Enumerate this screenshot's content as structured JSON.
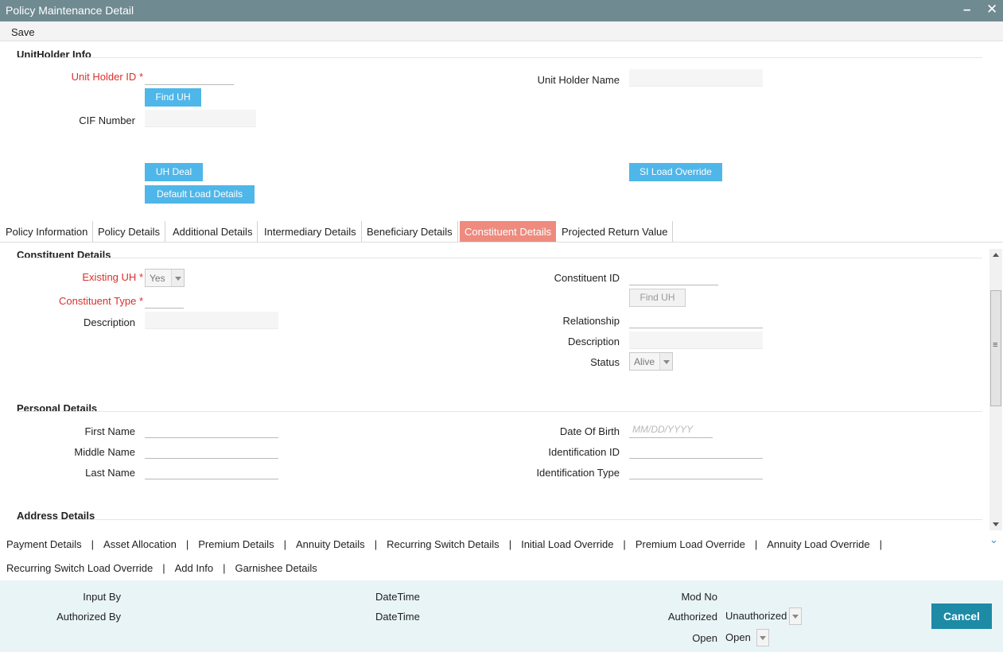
{
  "window": {
    "title": "Policy Maintenance Detail",
    "minimize": "–",
    "close": "✕"
  },
  "menu": {
    "save": "Save"
  },
  "unitholder": {
    "section": "UnitHolder Info",
    "unit_holder_id_label": "Unit Holder ID",
    "unit_holder_id_value": "",
    "find_uh_button": "Find UH",
    "cif_label": "CIF Number",
    "cif_value": "",
    "unit_holder_name_label": "Unit Holder Name",
    "unit_holder_name_value": "",
    "uh_deal_button": "UH Deal",
    "default_load_button": "Default Load Details",
    "si_load_override_button": "SI Load Override"
  },
  "tabs": [
    "Policy Information",
    "Policy Details",
    "Additional Details",
    "Intermediary Details",
    "Beneficiary Details",
    "Constituent Details",
    "Projected Return Value"
  ],
  "active_tab": "Constituent Details",
  "constituent": {
    "section": "Constituent Details",
    "existing_uh_label": "Existing UH",
    "existing_uh_value": "Yes",
    "constituent_type_label": "Constituent Type",
    "description_label": "Description",
    "constituent_id_label": "Constituent ID",
    "find_uh_button": "Find UH",
    "relationship_label": "Relationship",
    "description2_label": "Description",
    "status_label": "Status",
    "status_value": "Alive"
  },
  "personal": {
    "section": "Personal Details",
    "first_name_label": "First Name",
    "middle_name_label": "Middle Name",
    "last_name_label": "Last Name",
    "dob_label": "Date Of Birth",
    "dob_placeholder": "MM/DD/YYYY",
    "identification_id_label": "Identification ID",
    "identification_type_label": "Identification Type"
  },
  "address": {
    "section": "Address Details"
  },
  "links_row1": [
    "Payment Details",
    "Asset Allocation",
    "Premium Details",
    "Annuity Details",
    "Recurring Switch Details",
    "Initial Load Override",
    "Premium Load Override",
    "Annuity Load Override"
  ],
  "links_row2": [
    "Recurring Switch Load Override",
    "Add Info",
    "Garnishee Details"
  ],
  "separator": "|",
  "footer": {
    "input_by": "Input By",
    "datetime1": "DateTime",
    "mod_no": "Mod No",
    "authorized_by": "Authorized By",
    "datetime2": "DateTime",
    "authorized_label": "Authorized",
    "authorized_value": "Unauthorized",
    "open_label": "Open",
    "open_value": "Open",
    "cancel": "Cancel"
  },
  "colors": {
    "titlebar": "#6f8a90",
    "button": "#4fb6e9",
    "active_tab": "#ef8a7e",
    "required": "#d9302c",
    "footer_bg": "#e9f4f7",
    "cancel": "#1d8aa6"
  }
}
